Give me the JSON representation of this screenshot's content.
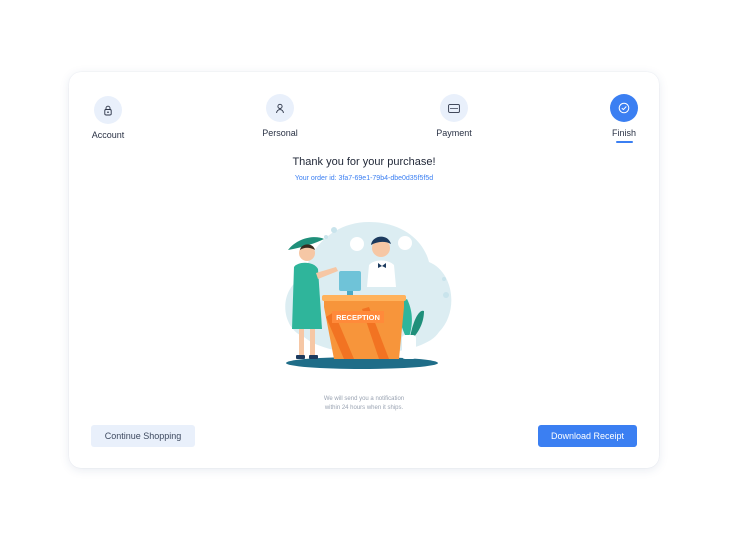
{
  "stepper": {
    "steps": [
      {
        "label": "Account",
        "icon": "lock-icon",
        "active": false
      },
      {
        "label": "Personal",
        "icon": "user-icon",
        "active": false
      },
      {
        "label": "Payment",
        "icon": "credit-card-icon",
        "active": false
      },
      {
        "label": "Finish",
        "icon": "check-circle-icon",
        "active": true
      }
    ]
  },
  "confirmation": {
    "title": "Thank you for your purchase!",
    "order_id": "Your order id: 3fa7-69e1-79b4-dbe0d35f5f5d",
    "illustration_text": "RECEPTION",
    "note_line1": "We will send you a notification",
    "note_line2": "within 24 hours when it ships."
  },
  "actions": {
    "continue_label": "Continue Shopping",
    "download_label": "Download Receipt"
  },
  "colors": {
    "accent": "#3b7ff2",
    "accent_light": "#e9f0fb",
    "text_dark": "#1f2636",
    "muted": "#9aa3b2"
  }
}
